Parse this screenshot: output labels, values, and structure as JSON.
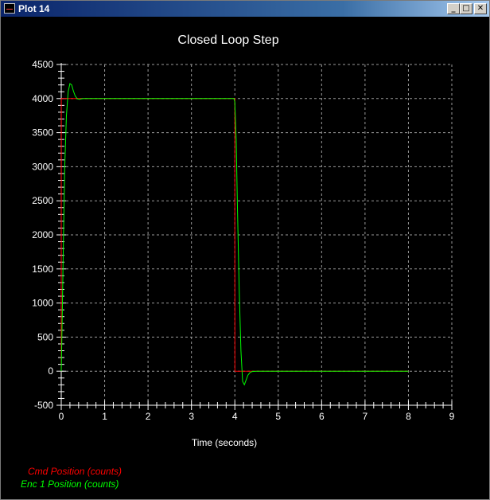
{
  "window": {
    "title": "Plot 14",
    "icons": {
      "app": "plot-window-icon",
      "minimize": "minimize-icon",
      "maximize": "maximize-icon",
      "close": "close-icon"
    }
  },
  "chart_data": {
    "type": "line",
    "title": "Closed Loop Step",
    "xlabel": "Time (seconds)",
    "ylabel": "",
    "xlim": [
      0,
      9
    ],
    "ylim": [
      -500,
      4500
    ],
    "xticks": [
      0,
      1,
      2,
      3,
      4,
      5,
      6,
      7,
      8,
      9
    ],
    "yticks": [
      -500,
      0,
      500,
      1000,
      1500,
      2000,
      2500,
      3000,
      3500,
      4000,
      4500
    ],
    "grid": true,
    "legend_position": "bottom-left",
    "background": "#000000",
    "series": [
      {
        "name": "Cmd Position (counts)",
        "color": "#ff0000",
        "x": [
          0,
          0.001,
          4.0,
          4.001,
          8.0
        ],
        "y": [
          0,
          4000,
          4000,
          0,
          0
        ]
      },
      {
        "name": "Enc 1 Position (counts)",
        "color": "#00ff00",
        "x": [
          0,
          0.02,
          0.05,
          0.08,
          0.12,
          0.16,
          0.2,
          0.24,
          0.28,
          0.32,
          0.37,
          0.42,
          0.5,
          0.8,
          3.98,
          4.0,
          4.03,
          4.06,
          4.1,
          4.14,
          4.18,
          4.22,
          4.26,
          4.3,
          4.35,
          4.4,
          4.5,
          4.8,
          8.0
        ],
        "y": [
          0,
          700,
          1900,
          3000,
          3750,
          4100,
          4220,
          4200,
          4110,
          4040,
          3995,
          3990,
          4000,
          4000,
          4000,
          3950,
          3400,
          2400,
          1200,
          300,
          -150,
          -200,
          -130,
          -60,
          -20,
          -5,
          0,
          0,
          0
        ]
      }
    ]
  }
}
